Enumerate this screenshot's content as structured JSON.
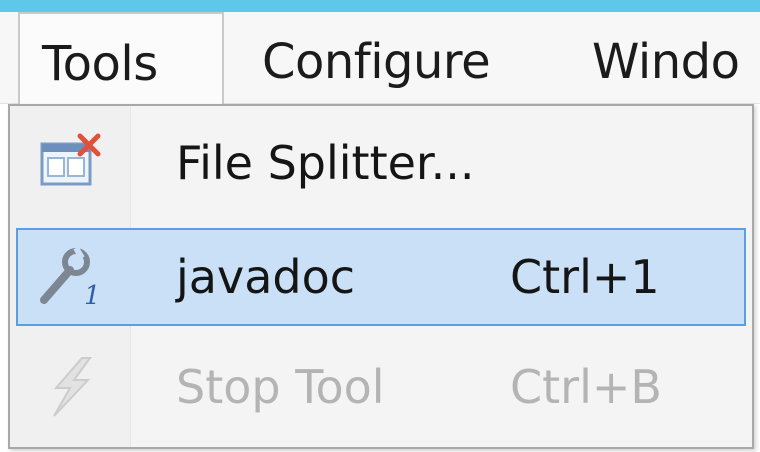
{
  "menubar": {
    "items": [
      {
        "label": "Tools",
        "state": "open"
      },
      {
        "label": "Configure",
        "state": "closed"
      },
      {
        "label": "Windo",
        "state": "closed"
      }
    ]
  },
  "dropdown": {
    "items": [
      {
        "label": "File Splitter...",
        "shortcut": "",
        "icon": "file-splitter-icon",
        "enabled": true,
        "highlighted": false
      },
      {
        "label": "javadoc",
        "shortcut": "Ctrl+1",
        "icon": "wrench-icon",
        "enabled": true,
        "highlighted": true
      },
      {
        "label": "Stop Tool",
        "shortcut": "Ctrl+B",
        "icon": "lightning-icon",
        "enabled": false,
        "highlighted": false
      }
    ]
  },
  "colors": {
    "accent_strip": "#5fc8ea",
    "highlight_fill": "#c9e0f7",
    "highlight_border": "#5b9fe2",
    "disabled_text": "#b4b4b4"
  }
}
